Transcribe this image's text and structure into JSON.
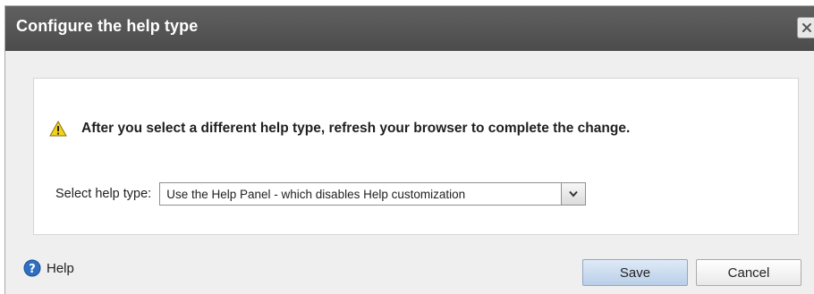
{
  "dialog": {
    "title": "Configure the help type",
    "close_icon": "close-icon"
  },
  "warning": {
    "icon": "warning-icon",
    "message": "After you select a different help type, refresh your browser to complete the change."
  },
  "select": {
    "label": "Select help type:",
    "value": "Use the Help Panel - which disables Help customization",
    "arrow_icon": "chevron-down-icon"
  },
  "footer": {
    "help_icon": "help-icon",
    "help_label": "Help",
    "save_label": "Save",
    "cancel_label": "Cancel"
  },
  "colors": {
    "titlebar": "#555555",
    "dialog_bg": "#efefef",
    "save_button": "#c9daf0"
  }
}
